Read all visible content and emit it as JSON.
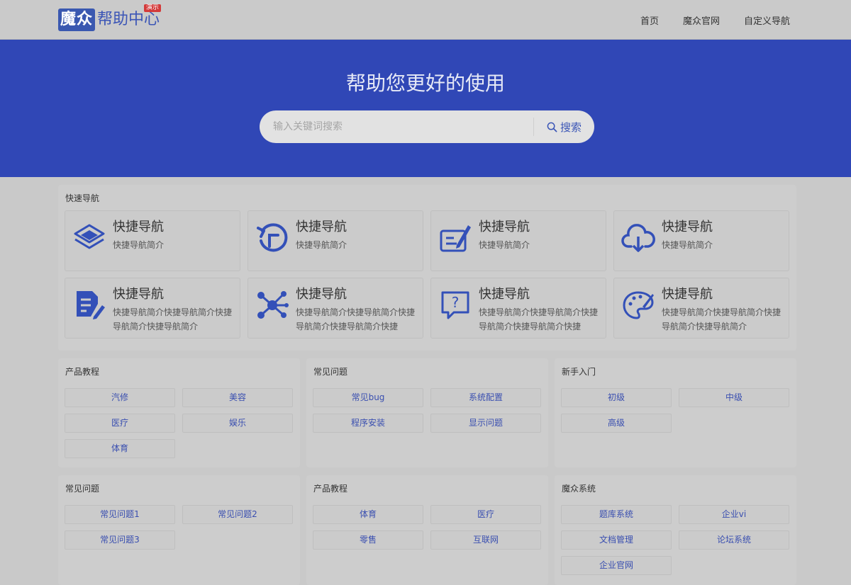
{
  "header": {
    "logo_box": "魔众",
    "logo_text": "帮助中心",
    "logo_badge": "演示",
    "nav": [
      "首页",
      "魔众官网",
      "自定义导航"
    ]
  },
  "hero": {
    "title": "帮助您更好的使用",
    "search_placeholder": "输入关键词搜索",
    "search_button": "搜索"
  },
  "quick_nav": {
    "title": "快速导航",
    "items": [
      {
        "title": "快捷导航",
        "desc": "快捷导航简介",
        "icon": "layers-icon"
      },
      {
        "title": "快捷导航",
        "desc": "快捷导航简介",
        "icon": "refresh-icon"
      },
      {
        "title": "快捷导航",
        "desc": "快捷导航简介",
        "icon": "edit-icon"
      },
      {
        "title": "快捷导航",
        "desc": "快捷导航简介",
        "icon": "cloud-download-icon"
      },
      {
        "title": "快捷导航",
        "desc": "快捷导航简介快捷导航简介快捷导航简介快捷导航简介",
        "icon": "document-edit-icon"
      },
      {
        "title": "快捷导航",
        "desc": "快捷导航简介快捷导航简介快捷导航简介快捷导航简介快捷",
        "icon": "network-icon"
      },
      {
        "title": "快捷导航",
        "desc": "快捷导航简介快捷导航简介快捷导航简介快捷导航简介快捷",
        "icon": "help-icon"
      },
      {
        "title": "快捷导航",
        "desc": "快捷导航简介快捷导航简介快捷导航简介快捷导航简介",
        "icon": "palette-icon"
      }
    ]
  },
  "categories": [
    {
      "title": "产品教程",
      "links": [
        "汽修",
        "美容",
        "医疗",
        "娱乐",
        "体育"
      ]
    },
    {
      "title": "常见问题",
      "links": [
        "常见bug",
        "系统配置",
        "程序安装",
        "显示问题"
      ]
    },
    {
      "title": "新手入门",
      "links": [
        "初级",
        "中级",
        "高级"
      ]
    },
    {
      "title": "常见问题",
      "links": [
        "常见问题1",
        "常见问题2",
        "常见问题3"
      ]
    },
    {
      "title": "产品教程",
      "links": [
        "体育",
        "医疗",
        "零售",
        "互联网"
      ]
    },
    {
      "title": "魔众系统",
      "links": [
        "题库系统",
        "企业vi",
        "文档管理",
        "论坛系统",
        "企业官网"
      ]
    }
  ],
  "colors": {
    "primary": "#3047b6",
    "link": "#3a4fb0"
  }
}
